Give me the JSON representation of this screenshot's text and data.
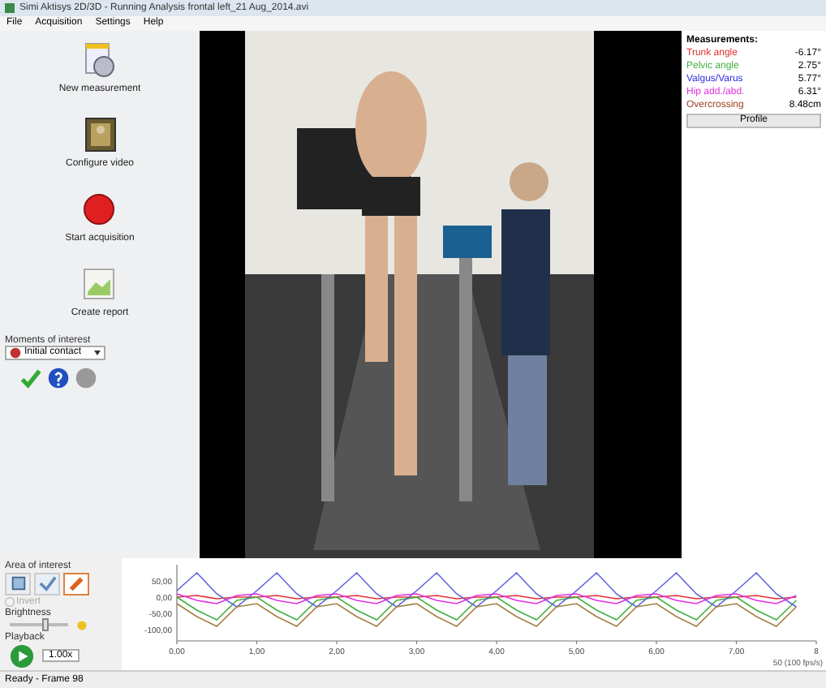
{
  "window": {
    "title": "Simi Aktisys 2D/3D - Running Analysis frontal left_21 Aug_2014.avi"
  },
  "menu": [
    "File",
    "Acquisition",
    "Settings",
    "Help"
  ],
  "sidebar": {
    "actions": [
      {
        "kind": "new",
        "label": "New measurement"
      },
      {
        "kind": "video",
        "label": "Configure video"
      },
      {
        "kind": "record",
        "label": "Start acquisition"
      },
      {
        "kind": "report",
        "label": "Create report"
      }
    ],
    "moments_label": "Moments of interest",
    "moment_select": {
      "value": "Initial contact"
    }
  },
  "video": {
    "kind": "picture"
  },
  "measurements": {
    "title": "Measurements:",
    "rows": [
      {
        "name": "Trunk angle",
        "value": "-6.17°",
        "color": "#e03030"
      },
      {
        "name": "Pelvic angle",
        "value": "2.75°",
        "color": "#40b040"
      },
      {
        "name": "Valgus/Varus",
        "value": "5.77°",
        "color": "#3030e0"
      },
      {
        "name": "Hip add./abd.",
        "value": "6.31°",
        "color": "#e030e0"
      },
      {
        "name": "Overcrossing",
        "value": "8.48cm",
        "color": "#a04020"
      }
    ],
    "button": "Profile"
  },
  "controls": {
    "area_label": "Area of interest",
    "area_tools": [
      {
        "kind": "square",
        "selected": false
      },
      {
        "kind": "check",
        "selected": false
      },
      {
        "kind": "brush",
        "selected": true
      }
    ],
    "invert": {
      "label": "Invert",
      "checked": false,
      "disabled": true
    },
    "brightness_label": "Brightness",
    "brightness": {
      "level": 0.6
    },
    "playback_label": "Playback",
    "speed": "1.00x"
  },
  "chart": {
    "chart_data": {
      "type": "line",
      "x": [
        0,
        0.25,
        0.5,
        0.75,
        1,
        1.25,
        1.5,
        1.75,
        2,
        2.25,
        2.5,
        2.75,
        3,
        3.25,
        3.5,
        3.75,
        4,
        4.25,
        4.5,
        4.75,
        5,
        5.25,
        5.5,
        5.75,
        6,
        6.25,
        6.5,
        6.75,
        7,
        7.25,
        7.5,
        7.75
      ],
      "series": [
        {
          "color": "#e03030",
          "values": [
            0,
            5,
            -5,
            0,
            0,
            5,
            -5,
            0,
            0,
            5,
            -5,
            0,
            0,
            5,
            -5,
            0,
            0,
            5,
            -5,
            0,
            0,
            5,
            -5,
            0,
            0,
            5,
            -5,
            0,
            0,
            5,
            -5,
            0
          ]
        },
        {
          "color": "#40b040",
          "values": [
            0,
            -40,
            -70,
            -10,
            0,
            -40,
            -70,
            -10,
            0,
            -40,
            -70,
            -10,
            0,
            -40,
            -70,
            -10,
            0,
            -40,
            -70,
            -10,
            0,
            -40,
            -70,
            -10,
            0,
            -40,
            -70,
            -10,
            0,
            -40,
            -70,
            -10
          ]
        },
        {
          "color": "#6060e0",
          "values": [
            20,
            75,
            10,
            -30,
            20,
            75,
            10,
            -30,
            20,
            75,
            10,
            -30,
            20,
            75,
            10,
            -30,
            20,
            75,
            10,
            -30,
            20,
            75,
            10,
            -30,
            20,
            75,
            10,
            -30,
            20,
            75,
            10,
            -30
          ]
        },
        {
          "color": "#e030e0",
          "values": [
            10,
            -10,
            -20,
            5,
            10,
            -10,
            -20,
            5,
            10,
            -10,
            -20,
            5,
            10,
            -10,
            -20,
            5,
            10,
            -10,
            -20,
            5,
            10,
            -10,
            -20,
            5,
            10,
            -10,
            -20,
            5,
            10,
            -10,
            -20,
            5
          ]
        },
        {
          "color": "#a08040",
          "values": [
            -20,
            -60,
            -90,
            -30,
            -20,
            -60,
            -90,
            -30,
            -20,
            -60,
            -90,
            -30,
            -20,
            -60,
            -90,
            -30,
            -20,
            -60,
            -90,
            -30,
            -20,
            -60,
            -90,
            -30,
            -20,
            -60,
            -90,
            -30,
            -20,
            -60,
            -90,
            -30
          ]
        }
      ],
      "xlim": [
        0,
        8
      ],
      "ylim": [
        -110,
        100
      ],
      "xticks": [
        {
          "value": 0,
          "label": "0,00"
        },
        {
          "value": 1,
          "label": "1,00"
        },
        {
          "value": 2,
          "label": "2,00"
        },
        {
          "value": 3,
          "label": "3,00"
        },
        {
          "value": 4,
          "label": "4,00"
        },
        {
          "value": 5,
          "label": "5,00"
        },
        {
          "value": 6,
          "label": "6,00"
        },
        {
          "value": 7,
          "label": "7,00"
        },
        {
          "value": 8,
          "label": "8"
        }
      ],
      "yticks": [
        {
          "value": 50,
          "label": "50,00"
        },
        {
          "value": 0,
          "label": "0,00"
        },
        {
          "value": -50,
          "label": "-50,00"
        },
        {
          "value": -100,
          "label": "-100,00"
        }
      ]
    },
    "rate": "50 (100 fps/s)"
  },
  "status_bar": "Ready - Frame 98"
}
